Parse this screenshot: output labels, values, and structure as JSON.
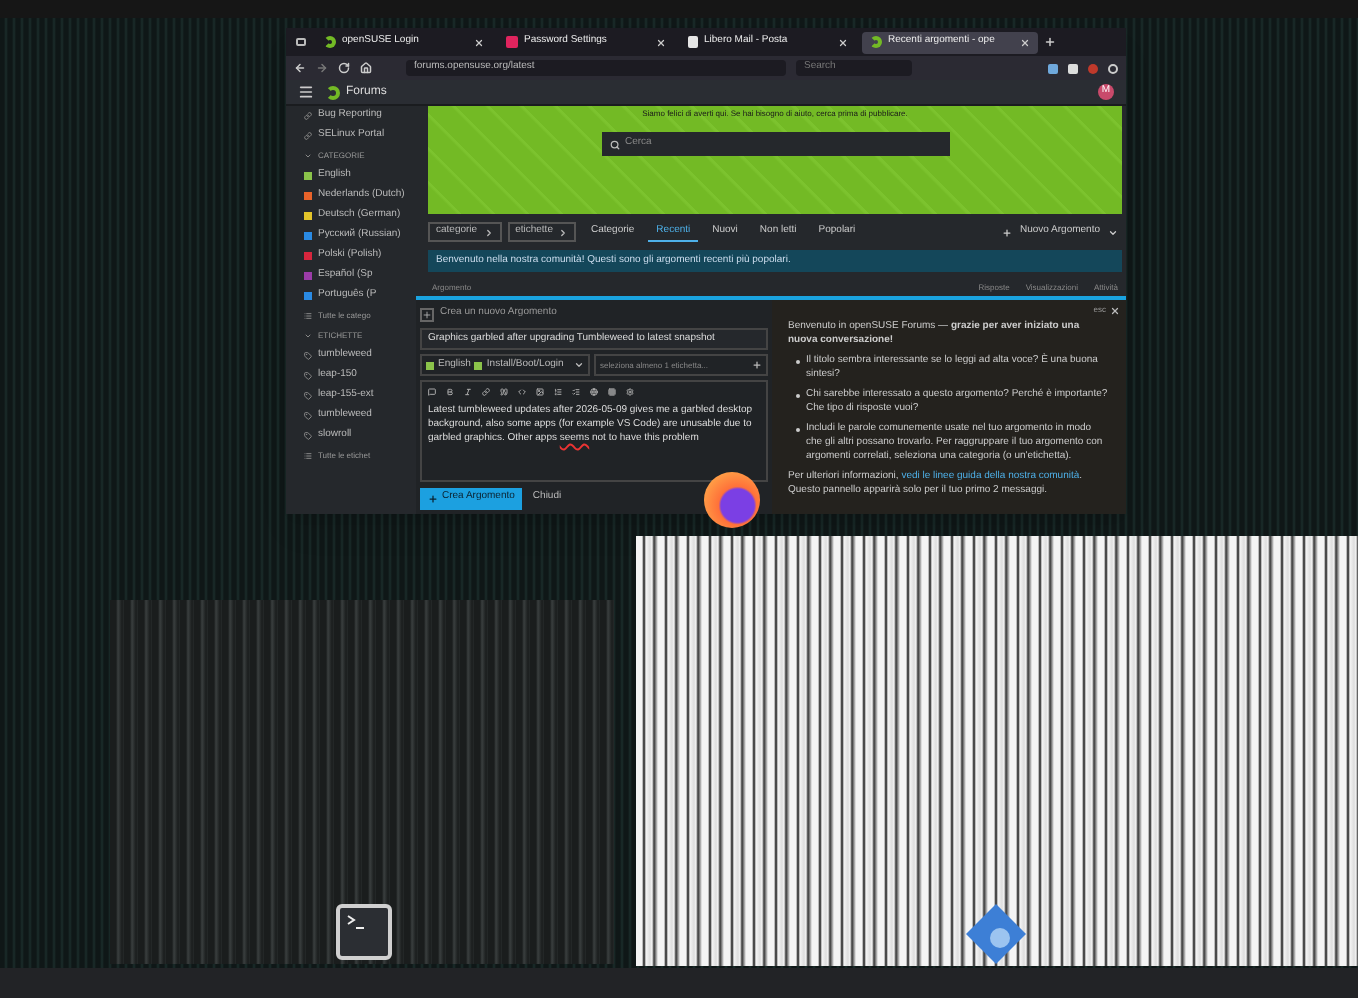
{
  "browser": {
    "tabs": [
      {
        "label": "openSUSE Login",
        "kind": "opensuse",
        "selected": false
      },
      {
        "label": "Password Settings",
        "kind": "key",
        "selected": false
      },
      {
        "label": "Libero Mail - Posta",
        "kind": "page",
        "selected": false
      },
      {
        "label": "Recenti argomenti - ope",
        "kind": "opensuse",
        "selected": true
      }
    ],
    "url": "forums.opensuse.org/latest",
    "search_placeholder": "Search"
  },
  "forum": {
    "title": "Forums",
    "avatar": "M"
  },
  "sidebar": {
    "links": [
      "Bug Reporting",
      "SELinux Portal"
    ],
    "categories_heading": "CATEGORIE",
    "categories": [
      {
        "label": "English",
        "color": "#8bc34a"
      },
      {
        "label": "Nederlands (Dutch)",
        "color": "#e8632a"
      },
      {
        "label": "Deutsch (German)",
        "color": "#e3c42a"
      },
      {
        "label": "Русский (Russian)",
        "color": "#2a8ae3"
      },
      {
        "label": "Polski (Polish)",
        "color": "#d7263d"
      },
      {
        "label": "Español (Sp",
        "color": "#9b3ca8"
      },
      {
        "label": "Português (P",
        "color": "#2a8ae3"
      }
    ],
    "categories_more": "Tutte le catego",
    "tags_heading": "ETICHETTE",
    "tags": [
      "tumbleweed",
      "leap-150",
      "leap-155-ext",
      "tumbleweed",
      "slowroll"
    ],
    "tags_more": "Tutte le etichet"
  },
  "banner": {
    "text": "Siamo felici di averti qui. Se hai bisogno di aiuto, cerca prima di pubblicare.",
    "search_placeholder": "Cerca"
  },
  "nav": {
    "dropdowns": [
      "categorie",
      "etichette"
    ],
    "tabs": [
      {
        "label": "Categorie",
        "selected": false
      },
      {
        "label": "Recenti",
        "selected": true
      },
      {
        "label": "Nuovi",
        "selected": false
      },
      {
        "label": "Non letti",
        "selected": false
      },
      {
        "label": "Popolari",
        "selected": false
      }
    ],
    "new_topic": "Nuovo Argomento"
  },
  "info": "Benvenuto nella nostra comunità! Questi sono gli argomenti recenti più popolari.",
  "table_columns": [
    "Argomento",
    "Risposte",
    "Visualizzazioni",
    "Attività"
  ],
  "composer": {
    "heading": "Crea un nuovo Argomento",
    "title": "Graphics garbled after upgrading Tumbleweed to latest snapshot",
    "categories": [
      {
        "label": "English",
        "color": "#8bc34a"
      },
      {
        "label": "Install/Boot/Login",
        "color": "#8bc34a"
      }
    ],
    "tags_placeholder": "seleziona almeno 1 etichetta...",
    "body": [
      {
        "text": "Latest tumbleweed updates after 2026-05-09 gives me a garbled desktop background, also some apps (for example VS Code) are unusable due to garbled graphics.  Other apps ",
        "misspelled": false
      },
      {
        "text": "seems",
        "misspelled": true
      },
      {
        "text": " not to have this problem",
        "misspelled": false
      }
    ],
    "submit": "Crea Argomento",
    "cancel": "Chiudi"
  },
  "tips": {
    "esc": "esc",
    "intro": "Benvenuto in openSUSE Forums — **grazie per aver iniziato una nuova conversazione!**",
    "bullets": [
      "Il titolo sembra interessante se lo leggi ad alta voce? È una buona sintesi?",
      "Chi sarebbe interessato a questo argomento? Perché è importante? Che tipo di risposte vuoi?",
      "Includi le parole comunemente usate nel tuo argomento in modo che gli altri possano trovarlo. Per raggruppare il tuo argomento con argomenti correlati, seleziona una categoria (o un'etichetta)."
    ],
    "footer_before": "Per ulteriori informazioni,",
    "footer_link": "vedi le linee guida della nostra comunità",
    "footer_after": ". Questo pannello apparirà solo per il tuo primo 2 messaggi."
  }
}
